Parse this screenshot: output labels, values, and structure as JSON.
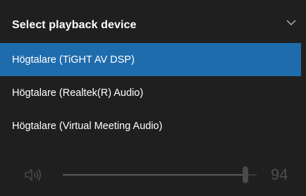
{
  "flyout": {
    "title": "Select playback device",
    "collapse_icon": "chevron-down-icon"
  },
  "devices": [
    {
      "label": "Högtalare (TiGHT AV DSP)",
      "selected": true
    },
    {
      "label": "Högtalare (Realtek(R) Audio)",
      "selected": false
    },
    {
      "label": "Högtalare (Virtual Meeting Audio)",
      "selected": false
    }
  ],
  "volume": {
    "icon": "speaker-icon",
    "value": "94",
    "level": 0.94
  },
  "colors": {
    "background": "#1f1f1f",
    "selection": "#1f6cad",
    "text": "#ffffff",
    "disabled_text": "#4d4d4d"
  }
}
